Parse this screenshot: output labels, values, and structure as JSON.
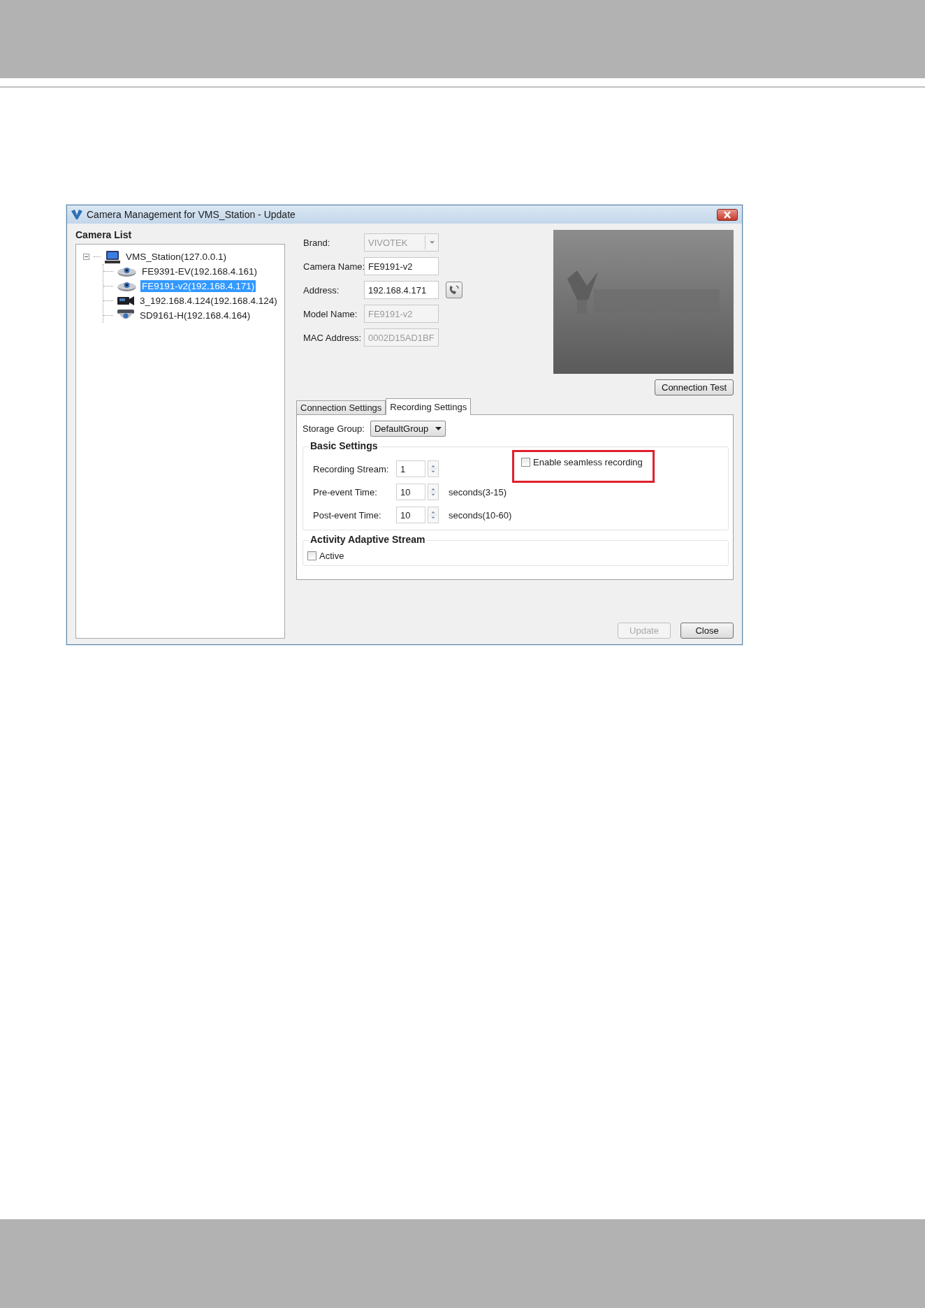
{
  "window": {
    "title": "Camera Management for VMS_Station - Update"
  },
  "camera_list": {
    "title": "Camera List",
    "tree": [
      {
        "label": "VMS_Station(127.0.0.1)",
        "kind": "server",
        "expanded": true,
        "selected": false,
        "children": [
          {
            "label": "FE9391-EV(192.168.4.161)",
            "kind": "fisheye",
            "selected": false
          },
          {
            "label": "FE9191-v2(192.168.4.171)",
            "kind": "fisheye",
            "selected": true
          },
          {
            "label": "3_192.168.4.124(192.168.4.124)",
            "kind": "box",
            "selected": false
          },
          {
            "label": "SD9161-H(192.168.4.164)",
            "kind": "dome",
            "selected": false
          }
        ]
      }
    ]
  },
  "details": {
    "fields": [
      {
        "label": "Brand:",
        "value": "VIVOTEK",
        "kind": "dropdown",
        "disabled": true
      },
      {
        "label": "Camera Name:",
        "value": "FE9191-v2",
        "kind": "text",
        "disabled": false
      },
      {
        "label": "Address:",
        "value": "192.168.4.171",
        "kind": "address",
        "disabled": false
      },
      {
        "label": "Model Name:",
        "value": "FE9191-v2",
        "kind": "text",
        "disabled": true
      },
      {
        "label": "MAC Address:",
        "value": "0002D15AD1BF",
        "kind": "text",
        "disabled": true
      }
    ]
  },
  "connection_test_button": "Connection Test",
  "tabs": [
    {
      "label": "Connection Settings",
      "selected": false
    },
    {
      "label": "Recording Settings",
      "selected": true
    }
  ],
  "recording": {
    "storage_group": {
      "label": "Storage Group:",
      "value": "DefaultGroup"
    },
    "basic_settings": {
      "title": "Basic Settings",
      "spinners": [
        {
          "label": "Recording Stream:",
          "value": "1"
        },
        {
          "label": "Pre-event Time:",
          "value": "10",
          "hint": "seconds(3-15)"
        },
        {
          "label": "Post-event Time:",
          "value": "10",
          "hint": "seconds(10-60)"
        }
      ],
      "seamless": {
        "label": "Enable seamless recording",
        "checked": false,
        "highlighted": true
      }
    },
    "adaptive": {
      "title": "Activity Adaptive Stream",
      "active": {
        "label": "Active",
        "checked": false
      }
    }
  },
  "buttons": [
    {
      "label": "Update",
      "disabled": true
    },
    {
      "label": "Close",
      "disabled": false
    }
  ]
}
